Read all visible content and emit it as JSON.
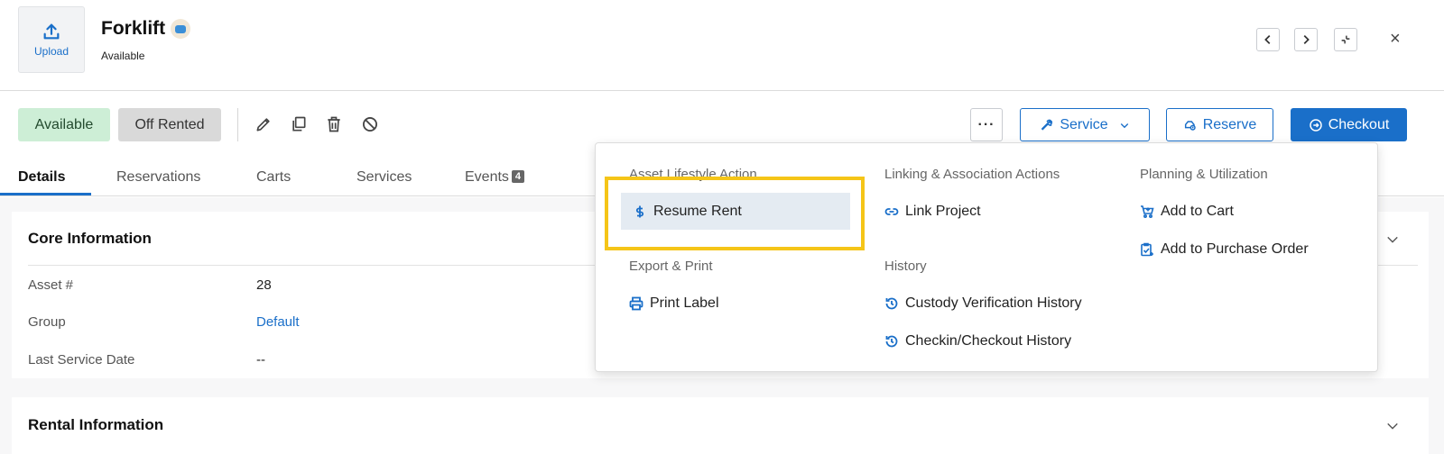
{
  "header": {
    "upload_label": "Upload",
    "title": "Forklift",
    "status": "Available",
    "close_glyph": "×"
  },
  "actions": {
    "status_available": "Available",
    "status_off_rented": "Off Rented",
    "more_label": "···",
    "service_label": "Service",
    "reserve_label": "Reserve",
    "checkout_label": "Checkout",
    "accent_color": "#1a6fc9"
  },
  "tabs": [
    {
      "label": "Details",
      "active": true
    },
    {
      "label": "Reservations"
    },
    {
      "label": "Carts"
    },
    {
      "label": "Services"
    },
    {
      "label": "Events",
      "count": "4"
    }
  ],
  "core": {
    "title": "Core Information",
    "fields": [
      {
        "label": "Asset #",
        "value": "28"
      },
      {
        "label": "Group",
        "value": "Default"
      },
      {
        "label": "Last Service Date",
        "value": "--"
      }
    ]
  },
  "rental": {
    "title": "Rental Information"
  },
  "dropdown": {
    "asset_lifestyle": {
      "heading": "Asset Lifestyle Action",
      "items": [
        {
          "label": "Resume Rent",
          "icon": "dollar-icon"
        }
      ]
    },
    "export_print": {
      "heading": "Export & Print",
      "items": [
        {
          "label": "Print Label",
          "icon": "printer-icon"
        }
      ]
    },
    "linking": {
      "heading": "Linking & Association Actions",
      "items": [
        {
          "label": "Link Project",
          "icon": "link-icon"
        }
      ]
    },
    "history": {
      "heading": "History",
      "items": [
        {
          "label": "Custody Verification History",
          "icon": "history-icon"
        },
        {
          "label": "Checkin/Checkout History",
          "icon": "history-icon"
        }
      ]
    },
    "planning": {
      "heading": "Planning & Utilization",
      "items": [
        {
          "label": "Add to Cart",
          "icon": "cart-icon"
        },
        {
          "label": "Add to Purchase Order",
          "icon": "purchase-order-icon"
        }
      ]
    },
    "highlight_color": "#f5c518"
  }
}
